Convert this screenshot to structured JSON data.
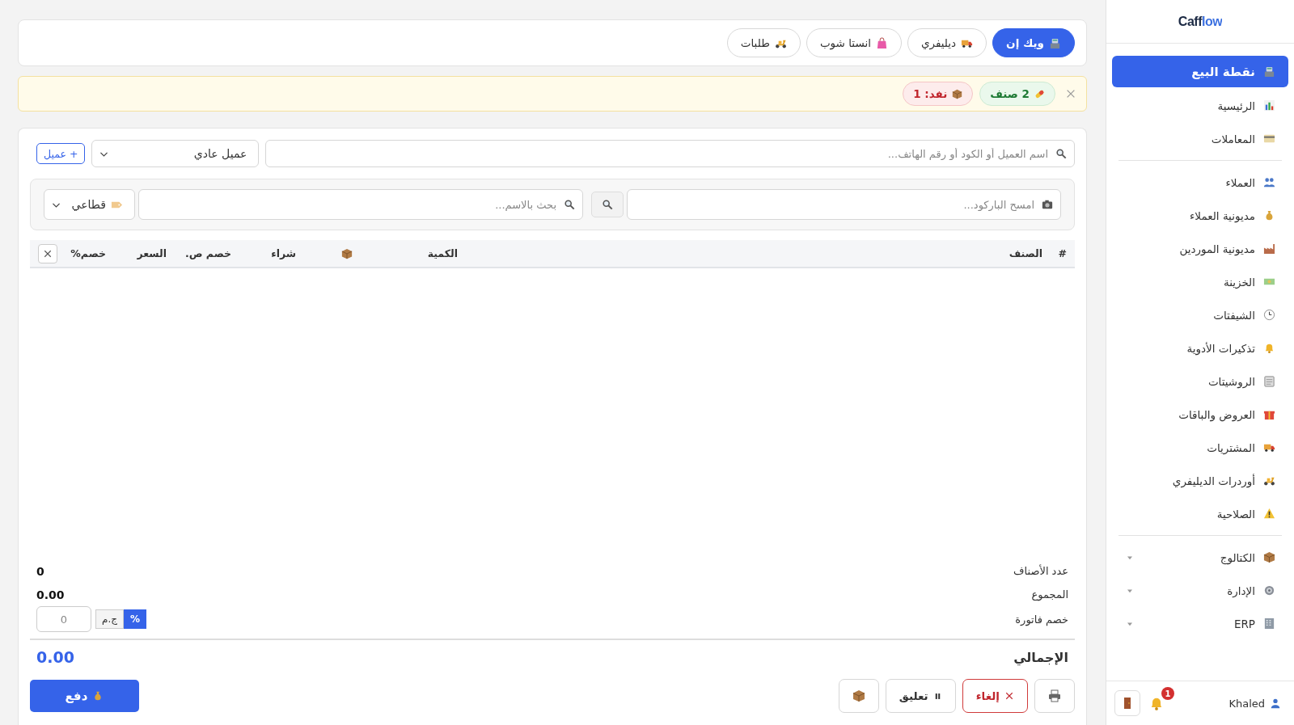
{
  "sales_tabs": [
    {
      "label": "ويك إن",
      "selected": true
    },
    {
      "label": "ديليفري",
      "selected": false
    },
    {
      "label": "انستا شوب",
      "selected": false
    },
    {
      "label": "طلبات",
      "selected": false
    }
  ],
  "alert": {
    "badges": [
      {
        "text": "2 صنف",
        "kind": "items"
      },
      {
        "text": "نفد: 1",
        "kind": "out"
      }
    ]
  },
  "customer": {
    "search_placeholder": "اسم العميل أو الكود أو رقم الهاتف...",
    "type": "عميل عادي",
    "add_button": "+ عميل"
  },
  "product_search": {
    "barcode_placeholder": "امسح الباركود...",
    "name_placeholder": "بحث بالاسم...",
    "price_type": "قطاعي"
  },
  "table": {
    "columns": [
      {
        "kind": "text",
        "label": "#"
      },
      {
        "kind": "text",
        "label": "الصنف"
      },
      {
        "kind": "text",
        "label": "الكمية"
      },
      {
        "kind": "icon"
      },
      {
        "kind": "text",
        "label": "شراء"
      },
      {
        "kind": "text",
        "label": "خصم ص."
      },
      {
        "kind": "text",
        "label": "السعر"
      },
      {
        "kind": "text",
        "label": "خصم%"
      }
    ]
  },
  "summary": {
    "item_count_label": "عدد الأصناف",
    "item_count": "0",
    "subtotal_label": "المجموع",
    "subtotal": "0.00",
    "discount_label": "خصم فاتورة",
    "discount_modes": [
      {
        "label": "%",
        "selected": true
      },
      {
        "label": "ج.م",
        "selected": false
      }
    ],
    "discount_placeholder": "0"
  },
  "total": {
    "label": "الإجمالي",
    "value": "0.00"
  },
  "actions": {
    "cancel": "إلغاء",
    "hold": "تعليق",
    "pay": "دفع"
  },
  "sidebar": {
    "logo": "Cafflow",
    "groups": [
      {
        "items": [
          {
            "label": "نقطة البيع",
            "selected": true
          },
          {
            "label": "الرئيسية",
            "selected": false
          },
          {
            "label": "المعاملات",
            "selected": false
          }
        ]
      },
      {
        "items": [
          {
            "label": "العملاء",
            "selected": false
          },
          {
            "label": "مديونية العملاء",
            "selected": false
          },
          {
            "label": "مديونية الموردين",
            "selected": false
          },
          {
            "label": "الخزينة",
            "selected": false
          },
          {
            "label": "الشيفتات",
            "selected": false
          },
          {
            "label": "تذكيرات الأدوية",
            "selected": false
          },
          {
            "label": "الروشيتات",
            "selected": false
          },
          {
            "label": "العروض والباقات",
            "selected": false
          },
          {
            "label": "المشتريات",
            "selected": false
          },
          {
            "label": "أوردرات الديليفري",
            "selected": false
          },
          {
            "label": "الصلاحية",
            "selected": false
          }
        ]
      },
      {
        "items": [
          {
            "label": "الكتالوج",
            "selected": false,
            "expanded": false
          },
          {
            "label": "الإدارة",
            "selected": false,
            "expanded": false
          },
          {
            "label": "ERP",
            "selected": false,
            "expanded": false
          }
        ]
      }
    ],
    "user": "Khaled",
    "notifications": "1"
  }
}
